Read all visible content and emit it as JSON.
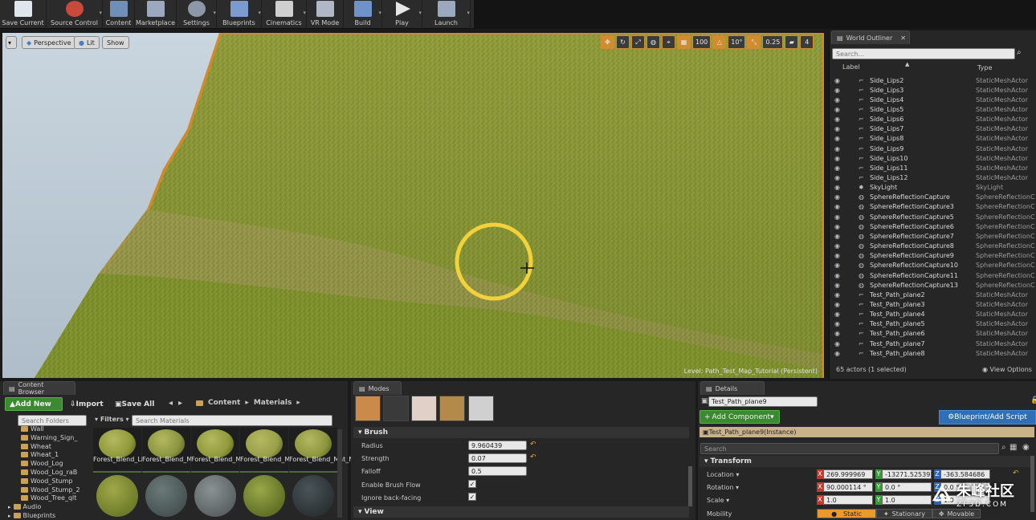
{
  "toolbar": {
    "items": [
      {
        "label": "Save Current",
        "icon": "save-icon",
        "color": "#dfe6ee"
      },
      {
        "label": "Source Control",
        "icon": "source-control-icon",
        "color": "#c74a3a"
      },
      {
        "label": "Content",
        "icon": "content-icon",
        "color": "#6f8fb8"
      },
      {
        "label": "Marketplace",
        "icon": "marketplace-icon",
        "color": "#9aa9c0"
      },
      {
        "label": "Settings",
        "icon": "settings-icon",
        "color": "#8c97a8"
      },
      {
        "label": "Blueprints",
        "icon": "blueprints-icon",
        "color": "#7a9ad0"
      },
      {
        "label": "Cinematics",
        "icon": "cinematics-icon",
        "color": "#cfcfcf"
      },
      {
        "label": "VR Mode",
        "icon": "vr-mode-icon",
        "color": "#b0b8c8"
      },
      {
        "label": "Build",
        "icon": "build-icon",
        "color": "#6f92c8"
      },
      {
        "label": "Play",
        "icon": "play-icon",
        "color": "#e6e6e6"
      },
      {
        "label": "Launch",
        "icon": "launch-icon",
        "color": "#9aa8c0"
      }
    ]
  },
  "viewport": {
    "view_mode": "Perspective",
    "lit": "Lit",
    "show": "Show",
    "grid_snap": "100",
    "rotation_snap": "10°",
    "scale_snap": "0.25",
    "camera_speed": "4",
    "level_label": "Level:  Path_Test_Map_Tutorial (Persistent)"
  },
  "outliner": {
    "tab": "World Outliner",
    "search_placeholder": "Search...",
    "col_label": "Label",
    "col_type": "Type",
    "rows": [
      {
        "name": "Side_Lips2",
        "type": "StaticMeshActor"
      },
      {
        "name": "Side_Lips3",
        "type": "StaticMeshActor"
      },
      {
        "name": "Side_Lips4",
        "type": "StaticMeshActor"
      },
      {
        "name": "Side_Lips5",
        "type": "StaticMeshActor"
      },
      {
        "name": "Side_Lips6",
        "type": "StaticMeshActor"
      },
      {
        "name": "Side_Lips7",
        "type": "StaticMeshActor"
      },
      {
        "name": "Side_Lips8",
        "type": "StaticMeshActor"
      },
      {
        "name": "Side_Lips9",
        "type": "StaticMeshActor"
      },
      {
        "name": "Side_Lips10",
        "type": "StaticMeshActor"
      },
      {
        "name": "Side_Lips11",
        "type": "StaticMeshActor"
      },
      {
        "name": "Side_Lips12",
        "type": "StaticMeshActor"
      },
      {
        "name": "SkyLight",
        "type": "SkyLight"
      },
      {
        "name": "SphereReflectionCapture",
        "type": "SphereReflectionC"
      },
      {
        "name": "SphereReflectionCapture3",
        "type": "SphereReflectionC"
      },
      {
        "name": "SphereReflectionCapture5",
        "type": "SphereReflectionC"
      },
      {
        "name": "SphereReflectionCapture6",
        "type": "SphereReflectionC"
      },
      {
        "name": "SphereReflectionCapture7",
        "type": "SphereReflectionC"
      },
      {
        "name": "SphereReflectionCapture8",
        "type": "SphereReflectionC"
      },
      {
        "name": "SphereReflectionCapture9",
        "type": "SphereReflectionC"
      },
      {
        "name": "SphereReflectionCapture10",
        "type": "SphereReflectionC"
      },
      {
        "name": "SphereReflectionCapture11",
        "type": "SphereReflectionC"
      },
      {
        "name": "SphereReflectionCapture13",
        "type": "SphereReflectionC"
      },
      {
        "name": "Test_Path_plane2",
        "type": "StaticMeshActor"
      },
      {
        "name": "Test_Path_plane3",
        "type": "StaticMeshActor"
      },
      {
        "name": "Test_Path_plane4",
        "type": "StaticMeshActor"
      },
      {
        "name": "Test_Path_plane5",
        "type": "StaticMeshActor"
      },
      {
        "name": "Test_Path_plane6",
        "type": "StaticMeshActor"
      },
      {
        "name": "Test_Path_plane7",
        "type": "StaticMeshActor"
      },
      {
        "name": "Test_Path_plane8",
        "type": "StaticMeshActor"
      }
    ],
    "actor_count": "65 actors (1 selected)",
    "view_options": "View Options"
  },
  "content_browser": {
    "tab": "Content Browser",
    "add_new": "Add New",
    "import": "Import",
    "save_all": "Save All",
    "path": [
      "Content",
      "Materials"
    ],
    "search_folders": "Search Folders",
    "filters": "Filters",
    "search_materials": "Search Materials",
    "folders": [
      "Wall",
      "Warning_Sign_",
      "Wheat",
      "Wheat_1",
      "Wood_Log",
      "Wood_Log_raB",
      "Wood_Stump",
      "Wood_Stump_2",
      "Wood_Tree_qlt",
      "Audio",
      "Blueprints"
    ],
    "assets": [
      {
        "name": "Forest_Blend_Lips"
      },
      {
        "name": "Forest_Blend_Mat"
      },
      {
        "name": "Forest_Blend_Mat_Inst"
      },
      {
        "name": "Forest_Blend_Mat_Inst1"
      },
      {
        "name": "Forest_Blend_Mat_NoDisp"
      }
    ]
  },
  "modes": {
    "tab": "Modes",
    "brush_header": "Brush",
    "view_header": "View",
    "radius_label": "Radius",
    "radius": "9.960439",
    "strength_label": "Strength",
    "strength": "0.07",
    "falloff_label": "Falloff",
    "falloff": "0.5",
    "flow_label": "Enable Brush Flow",
    "backface_label": "Ignore back-facing"
  },
  "details": {
    "tab": "Details",
    "name": "Test_Path_plane9",
    "add_component": "Add Component",
    "blueprint_script": "Blueprint/Add Script",
    "instance": "Test_Path_plane9(Instance)",
    "search_placeholder": "Search",
    "transform_header": "Transform",
    "location_label": "Location",
    "location": [
      "269.999969 cm",
      "-13271.525391",
      "-363.584686 cm"
    ],
    "rotation_label": "Rotation",
    "rotation": [
      "90.000114 °",
      "0.0 °",
      "0.0 °"
    ],
    "scale_label": "Scale",
    "scale": [
      "1.0",
      "1.0",
      "1.0"
    ],
    "mobility_label": "Mobility",
    "mobility": [
      "Static",
      "Stationary",
      "Movable"
    ]
  },
  "watermark": {
    "text": "朱峰社区",
    "sub": "ZF3D.COM"
  }
}
